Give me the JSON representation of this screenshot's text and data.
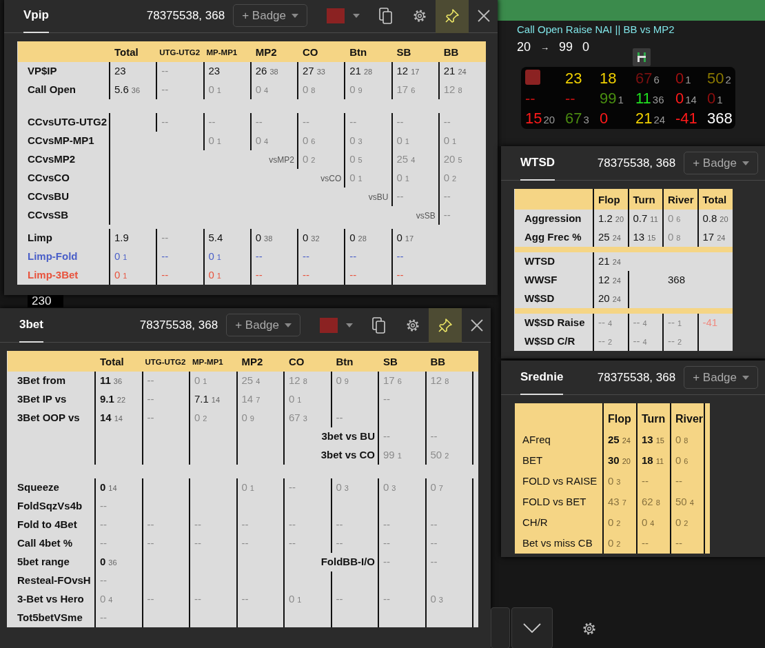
{
  "seat_label": "230",
  "hud": {
    "title": "Call Open Raise NAI || BB vs MP2",
    "line": [
      {
        "kind": "number",
        "text": "20"
      },
      {
        "kind": "arrow",
        "text": "→"
      },
      {
        "kind": "number",
        "text": "99"
      },
      {
        "kind": "number",
        "text": "0"
      }
    ],
    "rows": [
      [
        {
          "kind": "swatch",
          "color": "#8b2222"
        },
        {
          "kind": "stat",
          "value": "23",
          "color": "#f0d000"
        },
        {
          "kind": "stat",
          "value": "18",
          "color": "#f0d000"
        },
        {
          "kind": "stat",
          "value": "67",
          "sample": "6",
          "color": "#7a1010"
        },
        {
          "kind": "stat",
          "value": "0",
          "sample": "1",
          "color": "#a01010"
        },
        {
          "kind": "stat",
          "value": "50",
          "sample": "2",
          "color": "#8a7800"
        }
      ],
      [
        {
          "kind": "stat",
          "value": "--",
          "color": "#c01010"
        },
        {
          "kind": "stat",
          "value": "--",
          "color": "#c01010"
        },
        {
          "kind": "stat",
          "value": "99",
          "sample": "1",
          "color": "#4a9010"
        },
        {
          "kind": "stat",
          "value": "11",
          "sample": "36",
          "color": "#20e020"
        },
        {
          "kind": "stat",
          "value": "0",
          "sample": "14",
          "color": "#ff1a1a"
        },
        {
          "kind": "stat",
          "value": "0",
          "sample": "1",
          "color": "#900f0f"
        }
      ],
      [
        {
          "kind": "stat",
          "value": "15",
          "sample": "20",
          "color": "#ff1a1a"
        },
        {
          "kind": "stat",
          "value": "67",
          "sample": "3",
          "color": "#4a8a10"
        },
        {
          "kind": "stat",
          "value": "0",
          "color": "#ff1a1a"
        },
        {
          "kind": "stat",
          "value": "21",
          "sample": "24",
          "color": "#f0d000"
        },
        {
          "kind": "stat",
          "value": "-41",
          "color": "#ff1a1a"
        },
        {
          "kind": "stat",
          "value": "368",
          "color": "#ffffff"
        }
      ]
    ]
  },
  "windows": [
    {
      "title": "Vpip",
      "player": "78375538, 368",
      "badge": "+ Badge",
      "color": "#8b2222",
      "pinned": true,
      "table": {
        "columns": [
          {
            "label": "Total",
            "kind": "wide"
          },
          {
            "label": "UTG-UTG2",
            "kind": "narrow"
          },
          {
            "label": "MP-MP1",
            "kind": "narrow"
          },
          {
            "label": "MP2",
            "kind": "wide"
          },
          {
            "label": "CO",
            "kind": "wide"
          },
          {
            "label": "Btn",
            "kind": "wide"
          },
          {
            "label": "SB",
            "kind": "wide"
          },
          {
            "label": "BB",
            "kind": "wide"
          }
        ],
        "rows": [
          {
            "kind": "stats",
            "label": "VP$IP",
            "cells": [
              {
                "value": "23",
                "kind": "plain"
              },
              {
                "value": "--",
                "kind": "muted"
              },
              {
                "value": "23",
                "kind": "plain"
              },
              {
                "value": "26",
                "sample": "38",
                "kind": "plain"
              },
              {
                "value": "27",
                "sample": "33",
                "kind": "plain"
              },
              {
                "value": "21",
                "sample": "28",
                "kind": "plain"
              },
              {
                "value": "12",
                "sample": "17",
                "kind": "plain"
              },
              {
                "value": "21",
                "sample": "24",
                "kind": "plain"
              }
            ]
          },
          {
            "kind": "stats",
            "label": "Call Open",
            "cells": [
              {
                "value": "5.6",
                "sample": "36",
                "kind": "plain"
              },
              {
                "value": "--",
                "kind": "muted"
              },
              {
                "value": "0",
                "sample": "1",
                "kind": "muted"
              },
              {
                "value": "0",
                "sample": "4",
                "kind": "muted"
              },
              {
                "value": "0",
                "sample": "8",
                "kind": "muted"
              },
              {
                "value": "0",
                "sample": "9",
                "kind": "muted"
              },
              {
                "value": "17",
                "sample": "6",
                "kind": "muted"
              },
              {
                "value": "12",
                "sample": "8",
                "kind": "muted"
              }
            ]
          },
          {
            "kind": "spacer"
          },
          {
            "kind": "stats",
            "label": "CCvsUTG-UTG2",
            "cells": [
              {
                "kind": "empty"
              },
              {
                "value": "--",
                "kind": "muted"
              },
              {
                "value": "--",
                "kind": "muted"
              },
              {
                "value": "--",
                "kind": "muted"
              },
              {
                "value": "--",
                "kind": "muted"
              },
              {
                "value": "--",
                "kind": "muted"
              },
              {
                "value": "--",
                "kind": "muted"
              },
              {
                "value": "--",
                "kind": "muted"
              }
            ]
          },
          {
            "kind": "stats",
            "label": "CCvsMP-MP1",
            "cells": [
              {
                "kind": "empty"
              },
              {
                "kind": "gap"
              },
              {
                "value": "0",
                "sample": "1",
                "kind": "muted"
              },
              {
                "value": "0",
                "sample": "4",
                "kind": "muted"
              },
              {
                "value": "0",
                "sample": "6",
                "kind": "muted"
              },
              {
                "value": "0",
                "sample": "3",
                "kind": "muted"
              },
              {
                "value": "0",
                "sample": "1",
                "kind": "muted"
              },
              {
                "value": "0",
                "sample": "1",
                "kind": "muted"
              }
            ]
          },
          {
            "kind": "stats",
            "label": "CCvsMP2",
            "cells": [
              {
                "kind": "empty"
              },
              {
                "kind": "gap"
              },
              {
                "kind": "gap"
              },
              {
                "value": "vsMP2",
                "kind": "note"
              },
              {
                "value": "0",
                "sample": "2",
                "kind": "muted"
              },
              {
                "value": "0",
                "sample": "5",
                "kind": "muted"
              },
              {
                "value": "25",
                "sample": "4",
                "kind": "muted"
              },
              {
                "value": "20",
                "sample": "5",
                "kind": "muted"
              }
            ]
          },
          {
            "kind": "stats",
            "label": "CCvsCO",
            "cells": [
              {
                "kind": "empty"
              },
              {
                "kind": "gap"
              },
              {
                "kind": "gap"
              },
              {
                "kind": "gap"
              },
              {
                "value": "vsCO",
                "kind": "note"
              },
              {
                "value": "0",
                "sample": "1",
                "kind": "muted"
              },
              {
                "value": "0",
                "sample": "1",
                "kind": "muted"
              },
              {
                "value": "0",
                "sample": "2",
                "kind": "muted"
              }
            ]
          },
          {
            "kind": "stats",
            "label": "CCvsBU",
            "cells": [
              {
                "kind": "empty"
              },
              {
                "kind": "gap"
              },
              {
                "kind": "gap"
              },
              {
                "kind": "gap"
              },
              {
                "kind": "gap"
              },
              {
                "value": "vsBU",
                "kind": "note"
              },
              {
                "value": "--",
                "kind": "muted"
              },
              {
                "value": "--",
                "kind": "muted"
              }
            ]
          },
          {
            "kind": "stats",
            "label": "CCvsSB",
            "cells": [
              {
                "kind": "empty"
              },
              {
                "kind": "gap"
              },
              {
                "kind": "gap"
              },
              {
                "kind": "gap"
              },
              {
                "kind": "gap"
              },
              {
                "kind": "gap"
              },
              {
                "value": "vsSB",
                "kind": "note"
              },
              {
                "value": "--",
                "kind": "muted"
              }
            ]
          },
          {
            "kind": "break"
          },
          {
            "kind": "stats",
            "label": "Limp",
            "cells": [
              {
                "value": "1.9",
                "kind": "plain"
              },
              {
                "value": "--",
                "kind": "muted"
              },
              {
                "value": "5.4",
                "kind": "plain"
              },
              {
                "value": "0",
                "sample": "38",
                "kind": "plain"
              },
              {
                "value": "0",
                "sample": "32",
                "kind": "plain"
              },
              {
                "value": "0",
                "sample": "28",
                "kind": "plain"
              },
              {
                "value": "0",
                "sample": "17",
                "kind": "plain"
              },
              {
                "kind": "gap"
              }
            ]
          },
          {
            "kind": "stats",
            "label": "Limp-Fold",
            "color": "#4a5fc8",
            "cells": [
              {
                "value": "0",
                "sample": "1",
                "kind": "muted"
              },
              {
                "value": "--",
                "kind": "muted"
              },
              {
                "value": "0",
                "sample": "1",
                "kind": "muted"
              },
              {
                "value": "--",
                "kind": "muted"
              },
              {
                "value": "--",
                "kind": "muted"
              },
              {
                "value": "--",
                "kind": "muted"
              },
              {
                "value": "--",
                "kind": "muted"
              },
              {
                "kind": "gap"
              }
            ]
          },
          {
            "kind": "stats",
            "label": "Limp-3Bet",
            "color": "#e8533d",
            "cells": [
              {
                "value": "0",
                "sample": "1",
                "kind": "muted"
              },
              {
                "value": "--",
                "kind": "muted"
              },
              {
                "value": "0",
                "sample": "1",
                "kind": "muted"
              },
              {
                "value": "--",
                "kind": "muted"
              },
              {
                "value": "--",
                "kind": "muted"
              },
              {
                "value": "--",
                "kind": "muted"
              },
              {
                "value": "--",
                "kind": "muted"
              },
              {
                "kind": "gap"
              }
            ]
          }
        ]
      }
    },
    {
      "title": "3bet",
      "player": "78375538, 368",
      "badge": "+ Badge",
      "color": "#8b2222",
      "pinned": true,
      "table": {
        "columns": [
          {
            "label": "Total",
            "kind": "wide"
          },
          {
            "label": "UTG-UTG2",
            "kind": "narrow"
          },
          {
            "label": "MP-MP1",
            "kind": "narrow"
          },
          {
            "label": "MP2",
            "kind": "wide"
          },
          {
            "label": "CO",
            "kind": "wide"
          },
          {
            "label": "Btn",
            "kind": "wide"
          },
          {
            "label": "SB",
            "kind": "wide"
          },
          {
            "label": "BB",
            "kind": "wide"
          }
        ],
        "rows": [
          {
            "kind": "stats",
            "label": "3Bet from",
            "cells": [
              {
                "value": "11",
                "sample": "36",
                "kind": "strong"
              },
              {
                "value": "--",
                "kind": "muted"
              },
              {
                "value": "0",
                "sample": "1",
                "kind": "muted"
              },
              {
                "value": "25",
                "sample": "4",
                "kind": "muted"
              },
              {
                "value": "12",
                "sample": "8",
                "kind": "muted"
              },
              {
                "value": "0",
                "sample": "9",
                "kind": "muted"
              },
              {
                "value": "17",
                "sample": "6",
                "kind": "muted"
              },
              {
                "value": "12",
                "sample": "8",
                "kind": "muted"
              }
            ]
          },
          {
            "kind": "stats",
            "label": "3Bet IP vs",
            "cells": [
              {
                "value": "9.1",
                "sample": "22",
                "kind": "strong"
              },
              {
                "value": "--",
                "kind": "muted"
              },
              {
                "value": "7.1",
                "sample": "14",
                "kind": "plain"
              },
              {
                "value": "14",
                "sample": "7",
                "kind": "muted"
              },
              {
                "value": "0",
                "sample": "1",
                "kind": "muted"
              },
              {
                "kind": "empty"
              },
              {
                "value": "--",
                "kind": "muted"
              },
              {
                "kind": "empty"
              }
            ]
          },
          {
            "kind": "stats",
            "label": "3Bet OOP vs",
            "cells": [
              {
                "value": "14",
                "sample": "14",
                "kind": "strong"
              },
              {
                "value": "--",
                "kind": "muted"
              },
              {
                "value": "0",
                "sample": "2",
                "kind": "muted"
              },
              {
                "value": "0",
                "sample": "9",
                "kind": "muted"
              },
              {
                "value": "67",
                "sample": "3",
                "kind": "muted"
              },
              {
                "value": "--",
                "kind": "muted"
              },
              {
                "kind": "empty"
              },
              {
                "kind": "empty"
              }
            ]
          },
          {
            "kind": "stats",
            "cells": [
              {
                "kind": "empty"
              },
              {
                "kind": "empty"
              },
              {
                "kind": "empty"
              },
              {
                "kind": "empty"
              },
              {
                "kind": "empty"
              },
              {
                "value": "3bet vs BU",
                "kind": "tag"
              },
              {
                "value": "--",
                "kind": "muted"
              },
              {
                "value": "--",
                "kind": "muted"
              }
            ]
          },
          {
            "kind": "stats",
            "cells": [
              {
                "kind": "empty"
              },
              {
                "kind": "empty"
              },
              {
                "kind": "empty"
              },
              {
                "kind": "empty"
              },
              {
                "kind": "empty"
              },
              {
                "value": "3bet vs CO",
                "kind": "tag"
              },
              {
                "value": "99",
                "sample": "1",
                "kind": "muted"
              },
              {
                "value": "50",
                "sample": "2",
                "kind": "muted"
              }
            ]
          },
          {
            "kind": "spacer"
          },
          {
            "kind": "stats",
            "label": "Squeeze",
            "cells": [
              {
                "value": "0",
                "sample": "14",
                "kind": "strong"
              },
              {
                "kind": "empty"
              },
              {
                "kind": "empty"
              },
              {
                "value": "0",
                "sample": "1",
                "kind": "muted"
              },
              {
                "value": "--",
                "kind": "muted"
              },
              {
                "value": "0",
                "sample": "3",
                "kind": "muted"
              },
              {
                "value": "0",
                "sample": "3",
                "kind": "muted"
              },
              {
                "value": "0",
                "sample": "7",
                "kind": "muted"
              }
            ]
          },
          {
            "kind": "stats",
            "label": "FoldSqzVs4b",
            "cells": [
              {
                "value": "--",
                "kind": "muted"
              },
              {
                "kind": "empty"
              },
              {
                "kind": "empty"
              },
              {
                "kind": "empty"
              },
              {
                "kind": "empty"
              },
              {
                "kind": "empty"
              },
              {
                "kind": "empty"
              },
              {
                "kind": "empty"
              }
            ]
          },
          {
            "kind": "stats",
            "label": "Fold to 4Bet",
            "cells": [
              {
                "value": "--",
                "kind": "muted"
              },
              {
                "value": "--",
                "kind": "muted"
              },
              {
                "value": "--",
                "kind": "muted"
              },
              {
                "value": "--",
                "kind": "muted"
              },
              {
                "value": "--",
                "kind": "muted"
              },
              {
                "value": "--",
                "kind": "muted"
              },
              {
                "value": "--",
                "kind": "muted"
              },
              {
                "value": "--",
                "kind": "muted"
              }
            ]
          },
          {
            "kind": "stats",
            "label": "Call 4bet %",
            "cells": [
              {
                "value": "--",
                "kind": "muted"
              },
              {
                "value": "--",
                "kind": "muted"
              },
              {
                "value": "--",
                "kind": "muted"
              },
              {
                "value": "--",
                "kind": "muted"
              },
              {
                "value": "--",
                "kind": "muted"
              },
              {
                "value": "--",
                "kind": "muted"
              },
              {
                "value": "--",
                "kind": "muted"
              },
              {
                "value": "--",
                "kind": "muted"
              }
            ]
          },
          {
            "kind": "stats",
            "label": "5bet range",
            "cells": [
              {
                "value": "0",
                "sample": "36",
                "kind": "strong"
              },
              {
                "kind": "empty"
              },
              {
                "kind": "empty"
              },
              {
                "kind": "empty"
              },
              {
                "kind": "empty"
              },
              {
                "value": "FoldBB-I/O",
                "kind": "tag"
              },
              {
                "value": "--",
                "kind": "muted"
              },
              {
                "value": "--",
                "kind": "muted"
              }
            ]
          },
          {
            "kind": "stats",
            "label": "Resteal-FOvsH",
            "cells": [
              {
                "value": "--",
                "kind": "muted"
              },
              {
                "kind": "empty"
              },
              {
                "kind": "empty"
              },
              {
                "kind": "empty"
              },
              {
                "kind": "empty"
              },
              {
                "kind": "empty"
              },
              {
                "kind": "empty"
              },
              {
                "kind": "empty"
              }
            ]
          },
          {
            "kind": "stats",
            "label": "3-Bet vs Hero",
            "cells": [
              {
                "value": "0",
                "sample": "4",
                "kind": "muted"
              },
              {
                "value": "--",
                "kind": "muted"
              },
              {
                "value": "--",
                "kind": "muted"
              },
              {
                "value": "--",
                "kind": "muted"
              },
              {
                "value": "0",
                "sample": "1",
                "kind": "muted"
              },
              {
                "value": "--",
                "kind": "muted"
              },
              {
                "value": "--",
                "kind": "muted"
              },
              {
                "value": "0",
                "sample": "3",
                "kind": "muted"
              }
            ]
          },
          {
            "kind": "stats",
            "label": "Tot5betVSme",
            "cells": [
              {
                "value": "--",
                "kind": "muted"
              },
              {
                "kind": "empty"
              },
              {
                "kind": "empty"
              },
              {
                "kind": "empty"
              },
              {
                "kind": "empty"
              },
              {
                "kind": "empty"
              },
              {
                "kind": "empty"
              },
              {
                "kind": "empty"
              }
            ]
          }
        ]
      }
    },
    {
      "title": "WTSD",
      "player": "78375538, 368",
      "badge": "+ Badge",
      "table": {
        "columns": [
          {
            "label": "Flop",
            "kind": "wide"
          },
          {
            "label": "Turn",
            "kind": "wide"
          },
          {
            "label": "River",
            "kind": "wide"
          },
          {
            "label": "Total",
            "kind": "wide"
          }
        ],
        "rows": [
          {
            "kind": "stats",
            "label": "Aggression",
            "cells": [
              {
                "value": "1.2",
                "sample": "20",
                "kind": "plain"
              },
              {
                "value": "0.7",
                "sample": "11",
                "kind": "plain"
              },
              {
                "value": "0",
                "sample": "6",
                "kind": "muted"
              },
              {
                "value": "0.8",
                "sample": "20",
                "kind": "plain"
              }
            ]
          },
          {
            "kind": "stats",
            "label": "Agg Frec %",
            "cells": [
              {
                "value": "25",
                "sample": "24",
                "kind": "plain"
              },
              {
                "value": "13",
                "sample": "15",
                "kind": "plain"
              },
              {
                "value": "0",
                "sample": "8",
                "kind": "muted"
              },
              {
                "value": "17",
                "sample": "24",
                "kind": "plain"
              }
            ]
          },
          {
            "kind": "band"
          },
          {
            "kind": "stats",
            "label": "WTSD",
            "cells": [
              {
                "value": "21",
                "sample": "24",
                "kind": "plain"
              },
              {
                "kind": "gap"
              },
              {
                "kind": "gap"
              },
              {
                "kind": "gap"
              }
            ]
          },
          {
            "kind": "stats",
            "label": "WWSF",
            "cells": [
              {
                "value": "12",
                "sample": "24",
                "kind": "plain"
              },
              {
                "kind": "empty"
              },
              {
                "value": "368",
                "kind": "free"
              },
              {
                "kind": "gap"
              }
            ]
          },
          {
            "kind": "stats",
            "label": "W$SD",
            "cells": [
              {
                "value": "20",
                "sample": "24",
                "kind": "plain"
              },
              {
                "kind": "empty"
              },
              {
                "kind": "gap"
              },
              {
                "kind": "gap"
              }
            ]
          },
          {
            "kind": "band"
          },
          {
            "kind": "stats",
            "label": "W$SD Raise",
            "cells": [
              {
                "value": "--",
                "sample": "4",
                "kind": "muted"
              },
              {
                "value": "--",
                "sample": "4",
                "kind": "muted"
              },
              {
                "value": "--",
                "sample": "1",
                "kind": "muted"
              },
              {
                "value": "-41",
                "kind": "loss"
              }
            ]
          },
          {
            "kind": "stats",
            "label": "W$SD C/R",
            "cells": [
              {
                "value": "--",
                "sample": "2",
                "kind": "muted"
              },
              {
                "value": "--",
                "sample": "4",
                "kind": "muted"
              },
              {
                "value": "--",
                "sample": "2",
                "kind": "muted"
              },
              {
                "kind": "empty"
              }
            ]
          }
        ]
      }
    },
    {
      "title": "Srednie",
      "player": "78375538, 368",
      "badge": "+ Badge",
      "table": {
        "columns": [
          {
            "label": "Flop",
            "kind": "wide"
          },
          {
            "label": "Turn",
            "kind": "wide"
          },
          {
            "label": "River",
            "kind": "wide"
          }
        ],
        "rows": [
          {
            "kind": "stats",
            "label": "AFreq",
            "cells": [
              {
                "value": "25",
                "sample": "24",
                "kind": "strong"
              },
              {
                "value": "13",
                "sample": "15",
                "kind": "strong"
              },
              {
                "value": "0",
                "sample": "8",
                "kind": "muted"
              }
            ]
          },
          {
            "kind": "stats",
            "label": "BET",
            "cells": [
              {
                "value": "30",
                "sample": "20",
                "kind": "strong"
              },
              {
                "value": "18",
                "sample": "11",
                "kind": "strong"
              },
              {
                "value": "0",
                "sample": "6",
                "kind": "muted"
              }
            ]
          },
          {
            "kind": "stats",
            "label": "FOLD vs RAISE",
            "cells": [
              {
                "value": "0",
                "sample": "3",
                "kind": "muted"
              },
              {
                "value": "--",
                "kind": "muted"
              },
              {
                "value": "--",
                "kind": "muted"
              }
            ]
          },
          {
            "kind": "stats",
            "label": "FOLD vs BET",
            "cells": [
              {
                "value": "43",
                "sample": "7",
                "kind": "muted"
              },
              {
                "value": "62",
                "sample": "8",
                "kind": "muted"
              },
              {
                "value": "50",
                "sample": "4",
                "kind": "muted"
              }
            ]
          },
          {
            "kind": "stats",
            "label": "CH/R",
            "cells": [
              {
                "value": "0",
                "sample": "2",
                "kind": "muted"
              },
              {
                "value": "0",
                "sample": "4",
                "kind": "muted"
              },
              {
                "value": "0",
                "sample": "2",
                "kind": "muted"
              }
            ]
          },
          {
            "kind": "stats",
            "label": "Bet vs miss CB",
            "cells": [
              {
                "value": "0",
                "sample": "2",
                "kind": "muted"
              },
              {
                "value": "--",
                "kind": "muted"
              },
              {
                "value": "--",
                "kind": "muted"
              }
            ]
          }
        ]
      }
    }
  ]
}
